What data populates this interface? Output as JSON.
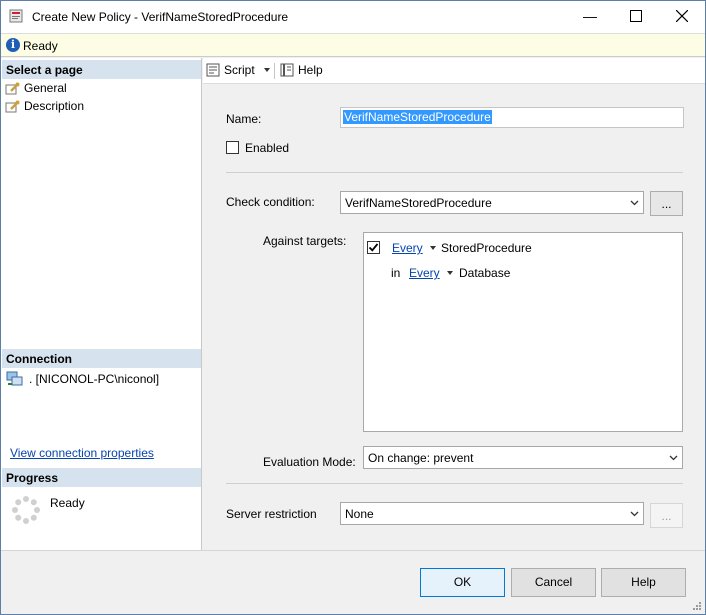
{
  "window": {
    "title": "Create New Policy - VerifNameStoredProcedure",
    "minimize_glyph": "—",
    "maximize_glyph": "☐",
    "close_glyph": "✕"
  },
  "status": {
    "icon": "info-icon",
    "icon_glyph": "i",
    "text": "Ready"
  },
  "left": {
    "select_header": "Select a page",
    "pages": [
      {
        "label": "General",
        "icon": "wrench-page-icon"
      },
      {
        "label": "Description",
        "icon": "wrench-page-icon"
      }
    ],
    "connection_header": "Connection",
    "connection_text": ". [NICONOL-PC\\niconol]",
    "connection_icon": "server-connection-icon",
    "view_connection_link": "View connection properties",
    "progress_header": "Progress",
    "progress_text": "Ready",
    "progress_icon": "spinner-icon"
  },
  "toolbar": {
    "script_label": "Script",
    "help_label": "Help"
  },
  "form": {
    "name_label": "Name:",
    "name_value": "VerifNameStoredProcedure",
    "enabled_label": "Enabled",
    "enabled_checked": false,
    "check_condition_label": "Check condition:",
    "check_condition_value": "VerifNameStoredProcedure",
    "ellipsis_label": "...",
    "against_targets_label": "Against targets:",
    "targets": {
      "row1": {
        "checked": true,
        "link": "Every",
        "target": "StoredProcedure"
      },
      "row2": {
        "prefix": "in",
        "link": "Every",
        "target": "Database"
      }
    },
    "evaluation_mode_label": "Evaluation Mode:",
    "evaluation_mode_value": "On change: prevent",
    "server_restriction_label": "Server restriction",
    "server_restriction_value": "None",
    "server_ellipsis_label": "..."
  },
  "footer": {
    "ok_label": "OK",
    "cancel_label": "Cancel",
    "help_label": "Help"
  },
  "colors": {
    "accent": "#0078d7",
    "link": "#0645ad",
    "selection": "#3399ff",
    "section_header": "#d6e2ee",
    "status_bg": "#fdfde6"
  }
}
